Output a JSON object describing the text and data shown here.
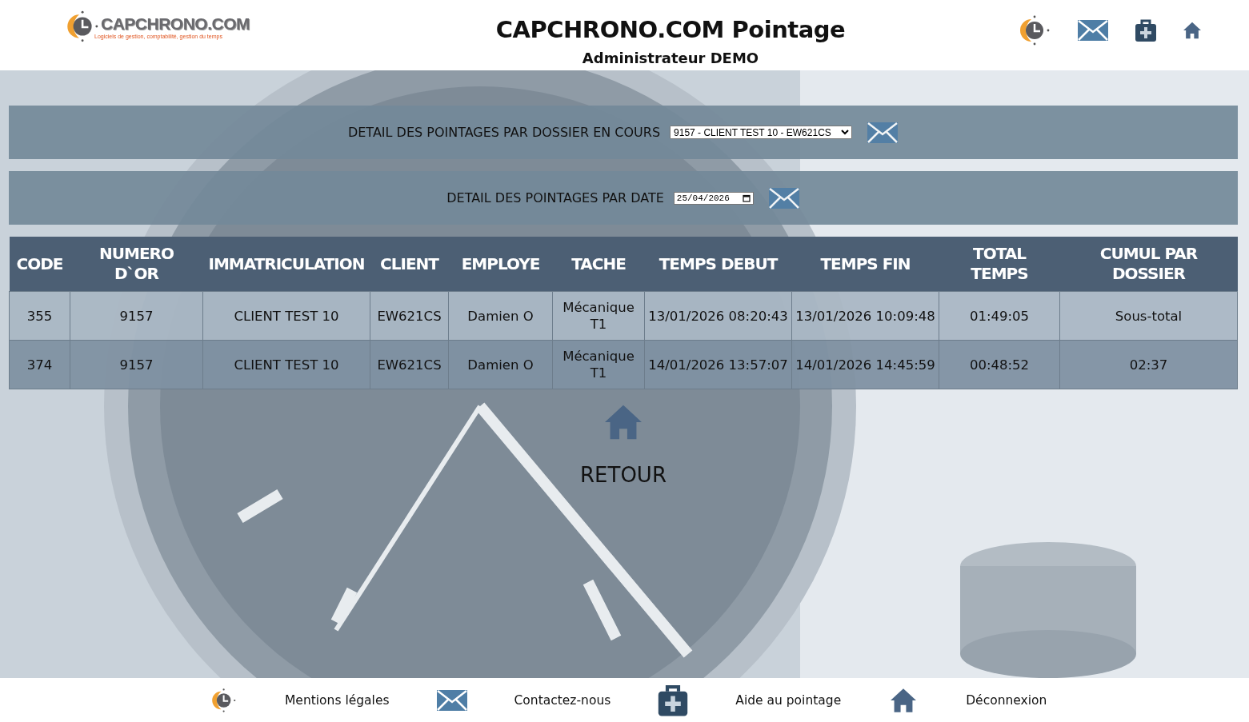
{
  "header": {
    "logo": {
      "name": "CAPCHRONO.COM",
      "tagline": "Logiciels de gestion, comptabilité, gestion du temps"
    },
    "title": "CAPCHRONO.COM Pointage",
    "subtitle": "Administrateur DEMO"
  },
  "filters": [
    {
      "kind": "select",
      "label": "DETAIL DES POINTAGES PAR DOSSIER EN COURS",
      "value": "9157 - CLIENT TEST 10 - EW621CS"
    },
    {
      "kind": "date",
      "label": "DETAIL DES POINTAGES PAR DATE",
      "value": "25/04/2026"
    }
  ],
  "table": {
    "columns": [
      "CODE",
      "NUMERO D`OR",
      "IMMATRICULATION",
      "CLIENT",
      "EMPLOYE",
      "TACHE",
      "TEMPS DEBUT",
      "TEMPS FIN",
      "TOTAL TEMPS",
      "CUMUL PAR DOSSIER"
    ],
    "rows": [
      [
        "355",
        "9157",
        "CLIENT TEST 10",
        "EW621CS",
        "Damien O",
        "Mécanique T1",
        "13/01/2026 08:20:43",
        "13/01/2026 10:09:48",
        "01:49:05",
        "Sous-total"
      ],
      [
        "374",
        "9157",
        "CLIENT TEST 10",
        "EW621CS",
        "Damien O",
        "Mécanique T1",
        "14/01/2026 13:57:07",
        "14/01/2026 14:45:59",
        "00:48:52",
        "02:37"
      ]
    ]
  },
  "back": {
    "label": "RETOUR"
  },
  "footer": [
    "Mentions légales",
    "Contactez-nous",
    "Aide au pointage",
    "Déconnexion"
  ]
}
